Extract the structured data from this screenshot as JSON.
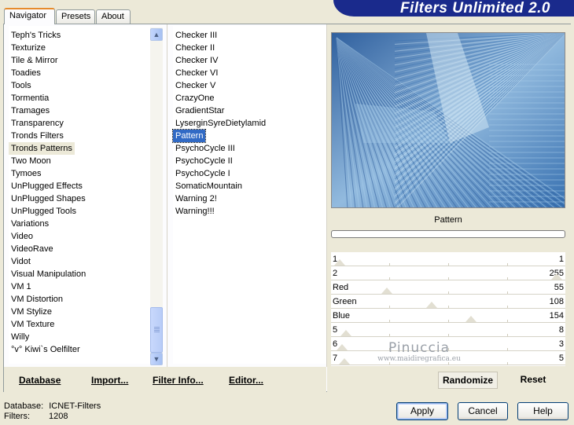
{
  "window": {
    "title": "Filters Unlimited 2.0"
  },
  "tabs": [
    {
      "label": "Navigator",
      "active": true
    },
    {
      "label": "Presets",
      "active": false
    },
    {
      "label": "About",
      "active": false
    }
  ],
  "categories": [
    "Teph's Tricks",
    "Texturize",
    "Tile & Mirror",
    "Toadies",
    "Tools",
    "Tormentia",
    "Tramages",
    "Transparency",
    "Tronds Filters",
    "Tronds Patterns",
    "Two Moon",
    "Tymoes",
    "UnPlugged Effects",
    "UnPlugged Shapes",
    "UnPlugged Tools",
    "Variations",
    "Video",
    "VideoRave",
    "Vidot",
    "Visual Manipulation",
    "VM 1",
    "VM Distortion",
    "VM Stylize",
    "VM Texture",
    "Willy",
    "°v° Kiwi`s Oelfilter"
  ],
  "selected_category": "Tronds Patterns",
  "filters": [
    "Checker III",
    "Checker II",
    "Checker IV",
    "Checker VI",
    "Checker V",
    "CrazyOne",
    "GradientStar",
    "LyserginSyreDietylamid",
    "Pattern",
    "PsychoCycle III",
    "PsychoCycle II",
    "PsychoCycle I",
    "SomaticMountain",
    "Warning 2!",
    "Warning!!!"
  ],
  "selected_filter": "Pattern",
  "links": {
    "database": "Database",
    "import": "Import...",
    "filter_info": "Filter Info...",
    "editor": "Editor..."
  },
  "preview": {
    "filter_name": "Pattern",
    "colors": {
      "dark": "#2E5C9A",
      "mid": "#3770B0",
      "light": "#A9CDEA",
      "pale": "#D6EAF6"
    }
  },
  "sliders": [
    {
      "label": "1",
      "value": "1",
      "fraction": 0.0
    },
    {
      "label": "2",
      "value": "255",
      "fraction": 1.0
    },
    {
      "label": "Red",
      "value": "55",
      "fraction": 0.216
    },
    {
      "label": "Green",
      "value": "108",
      "fraction": 0.424
    },
    {
      "label": "Blue",
      "value": "154",
      "fraction": 0.604
    },
    {
      "label": "5",
      "value": "8",
      "fraction": 0.03
    },
    {
      "label": "6",
      "value": "3",
      "fraction": 0.01
    },
    {
      "label": "7",
      "value": "5",
      "fraction": 0.02
    }
  ],
  "buttons": {
    "randomize": "Randomize",
    "reset": "Reset",
    "apply": "Apply",
    "cancel": "Cancel",
    "help": "Help"
  },
  "status": {
    "database_label": "Database:",
    "database_value": "ICNET-Filters",
    "filters_label": "Filters:",
    "filters_value": "1208"
  },
  "watermark": {
    "name": "Pinuccia",
    "url": "www.maidiregrafica.eu"
  }
}
